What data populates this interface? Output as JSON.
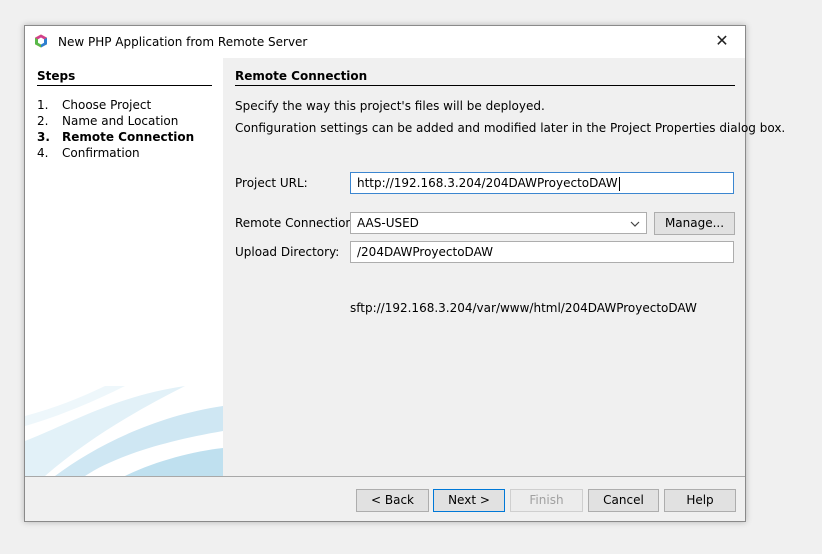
{
  "window": {
    "title": "New PHP Application from Remote Server",
    "close_icon": "close-icon",
    "app_icon": "netbeans-cube-icon"
  },
  "steps": {
    "title": "Steps",
    "items": [
      {
        "num": "1.",
        "label": "Choose Project",
        "current": false
      },
      {
        "num": "2.",
        "label": "Name and Location",
        "current": false
      },
      {
        "num": "3.",
        "label": "Remote Connection",
        "current": true
      },
      {
        "num": "4.",
        "label": "Confirmation",
        "current": false
      }
    ]
  },
  "panel": {
    "title": "Remote Connection",
    "desc1": "Specify the way this project's files will be deployed.",
    "desc2": "Configuration settings can be added and modified later in the Project Properties dialog box."
  },
  "form": {
    "project_url_label": "Project URL:",
    "project_url_value": "http://192.168.3.204/204DAWProyectoDAW",
    "remote_connection_label": "Remote Connection:",
    "remote_connection_value": "AAS-USED",
    "manage_label": "Manage...",
    "upload_directory_label": "Upload Directory:",
    "upload_directory_value": "/204DAWProyectoDAW",
    "resolved_path": "sftp://192.168.3.204/var/www/html/204DAWProyectoDAW"
  },
  "footer": {
    "back": "< Back",
    "next": "Next >",
    "finish": "Finish",
    "cancel": "Cancel",
    "help": "Help"
  },
  "colors": {
    "focus_border": "#3b86d0",
    "default_button_border": "#0078d7",
    "decoration": "#d6ecf5"
  }
}
